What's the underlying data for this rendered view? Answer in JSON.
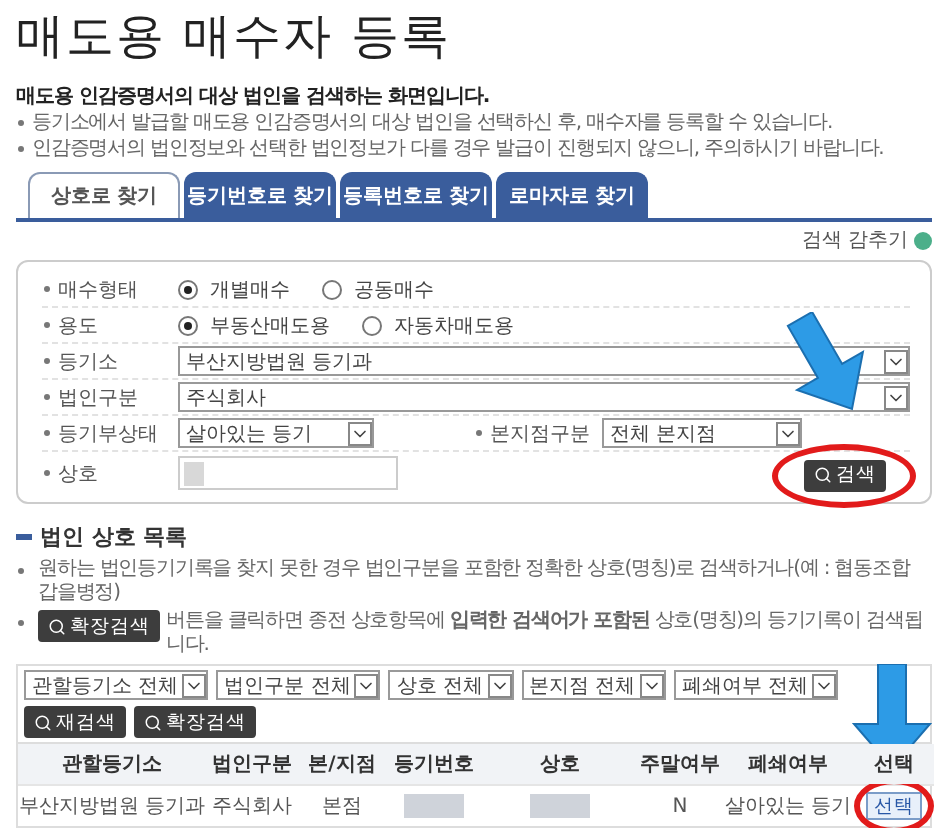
{
  "page_title": "매도용 매수자 등록",
  "intro": {
    "heading": "매도용 인감증명서의 대상 법인을 검색하는 화면입니다.",
    "bullets": [
      "등기소에서 발급할 매도용 인감증명서의 대상 법인을 선택하신 후, 매수자를 등록할 수 있습니다.",
      "인감증명서의 법인정보와 선택한 법인정보가 다를 경우 발급이 진행되지 않으니, 주의하시기 바랍니다."
    ]
  },
  "tabs": [
    {
      "label": "상호로 찾기",
      "selected": true
    },
    {
      "label": "등기번호로 찾기",
      "selected": false
    },
    {
      "label": "등록번호로 찾기",
      "selected": false
    },
    {
      "label": "로마자로 찾기",
      "selected": false
    }
  ],
  "toggle_link": "검색 감추기",
  "form": {
    "rows": [
      {
        "kind": "radio",
        "label": "매수형태",
        "options": [
          {
            "label": "개별매수",
            "selected": true
          },
          {
            "label": "공동매수",
            "selected": false
          }
        ]
      },
      {
        "kind": "radio",
        "label": "용도",
        "options": [
          {
            "label": "부동산매도용",
            "selected": true
          },
          {
            "label": "자동차매도용",
            "selected": false
          }
        ]
      },
      {
        "kind": "select",
        "label": "등기소",
        "value": "부산지방법원 등기과"
      },
      {
        "kind": "select",
        "label": "법인구분",
        "value": "주식회사"
      },
      {
        "kind": "pair",
        "label": "등기부상태",
        "value": "살아있는 등기",
        "label2": "본지점구분",
        "value2": "전체 본지점"
      },
      {
        "kind": "name",
        "label": "상호"
      }
    ],
    "search_button": "검색"
  },
  "list": {
    "title": "법인 상호 목록",
    "note1": "원하는 법인등기기록을 찾지 못한 경우 법인구분을 포함한 정확한 상호(명칭)로 검색하거나(예 : 협동조합 갑을병정)",
    "note2_button": "확장검색",
    "note2": "버튼을 클릭하면 종전 상호항목에 **입력한 검색어가 포함된** 상호(명칭)의 등기기록이 검색됩니다.",
    "filters": [
      "관할등기소 전체",
      "법인구분 전체",
      "상호 전체",
      "본지점 전체",
      "폐쇄여부 전체"
    ],
    "filter_buttons": [
      "재검색",
      "확장검색"
    ],
    "columns": [
      "관할등기소",
      "법인구분",
      "본/지점",
      "등기번호",
      "상호",
      "주말여부",
      "폐쇄여부",
      "선택"
    ],
    "rows": [
      {
        "cells": [
          {
            "kind": "text",
            "text": "부산지방법원 등기과"
          },
          {
            "kind": "text",
            "text": "주식회사"
          },
          {
            "kind": "text",
            "text": "본점"
          },
          {
            "kind": "redacted"
          },
          {
            "kind": "redacted"
          },
          {
            "kind": "text",
            "text": "N"
          },
          {
            "kind": "text",
            "text": "살아있는 등기"
          },
          {
            "kind": "button",
            "text": "선택"
          }
        ]
      }
    ]
  }
}
